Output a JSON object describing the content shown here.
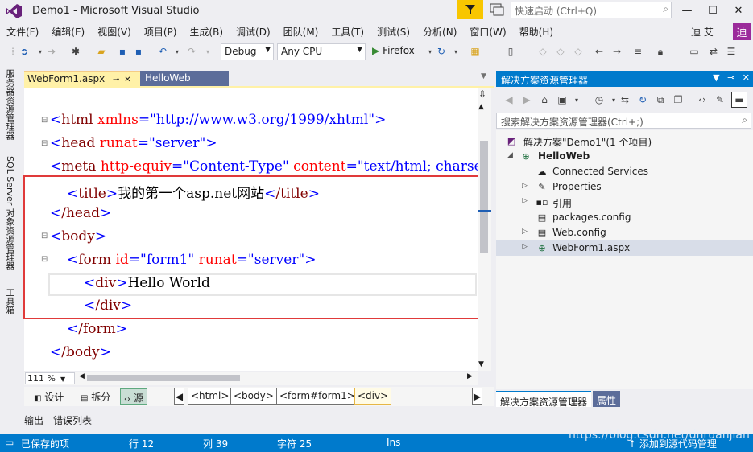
{
  "window": {
    "title": "Demo1 - Microsoft Visual Studio",
    "quick_launch_placeholder": "快速启动 (Ctrl+Q)",
    "user_name": "迪 艾",
    "user_initial": "迪"
  },
  "menu": [
    "文件(F)",
    "编辑(E)",
    "视图(V)",
    "项目(P)",
    "生成(B)",
    "调试(D)",
    "团队(M)",
    "工具(T)",
    "测试(S)",
    "分析(N)",
    "窗口(W)",
    "帮助(H)"
  ],
  "toolbar": {
    "config": "Debug",
    "platform": "Any CPU",
    "run_target": "Firefox"
  },
  "left_tabs": {
    "server_explorer": "服务器资源管理器",
    "sql_server": "SQL Server 对象资源管理器",
    "toolbox": "工具箱"
  },
  "doc_tabs": {
    "active": "WebForm1.aspx",
    "other": "HelloWeb"
  },
  "code": {
    "l1": {
      "tag": "html",
      "attr": "xmlns",
      "val": "http://www.w3.org/1999/xhtml"
    },
    "l2": {
      "tag": "head",
      "attr": "runat",
      "val": "\"server\""
    },
    "l3": {
      "tag": "meta",
      "attr1": "http-equiv",
      "val1": "\"Content-Type\"",
      "attr2": "content",
      "val2": "\"text/html; charset="
    },
    "l4": {
      "tag": "title",
      "text": "我的第一个asp.net网站",
      "close": "/title"
    },
    "l5": {
      "close": "/head"
    },
    "l6": {
      "tag": "body"
    },
    "l7": {
      "tag": "form",
      "attr1": "id",
      "val1": "\"form1\"",
      "attr2": "runat",
      "val2": "\"server\""
    },
    "l8": {
      "tag": "div",
      "text": "Hello World"
    },
    "l9": {
      "close": "/div"
    },
    "l10": {
      "close": "/form"
    },
    "l11": {
      "close": "/body"
    }
  },
  "editor": {
    "zoom": "111 %",
    "view_design": "设计",
    "view_split": "拆分",
    "view_source": "源",
    "breadcrumbs": [
      "<html>",
      "<body>",
      "<form#form1>",
      "<div>"
    ]
  },
  "solution_explorer": {
    "title": "解决方案资源管理器",
    "search_placeholder": "搜索解决方案资源管理器(Ctrl+;)",
    "items": [
      {
        "label": "解决方案\"Demo1\"(1 个项目)"
      },
      {
        "label": "HelloWeb"
      },
      {
        "label": "Connected Services"
      },
      {
        "label": "Properties"
      },
      {
        "label": "引用"
      },
      {
        "label": "packages.config"
      },
      {
        "label": "Web.config"
      },
      {
        "label": "WebForm1.aspx"
      }
    ],
    "tab_explorer": "解决方案资源管理器",
    "tab_properties": "属性"
  },
  "output_tabs": [
    "输出",
    "错误列表"
  ],
  "status": {
    "saved": "已保存的项",
    "line": "行 12",
    "col": "列 39",
    "char": "字符 25",
    "mode": "Ins",
    "source_control": "添加到源代码管理"
  },
  "watermark": "https://blog.csdn.net/dnruanjian"
}
